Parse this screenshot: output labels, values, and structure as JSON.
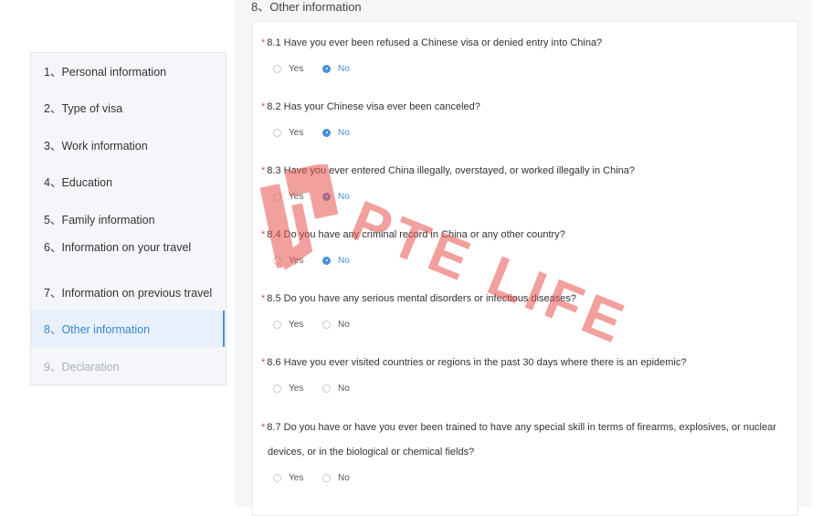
{
  "section": {
    "title": "8、Other information"
  },
  "sidebar": {
    "items": [
      {
        "label": "1、Personal information"
      },
      {
        "label": "2、Type of visa"
      },
      {
        "label": "3、Work information"
      },
      {
        "label": "4、Education"
      },
      {
        "label": "5、Family information"
      },
      {
        "label": "6、Information on your travel"
      },
      {
        "label": "7、Information on previous travel"
      },
      {
        "label": "8、Other information",
        "state": "active"
      },
      {
        "label": "9、Declaration",
        "state": "disabled"
      }
    ]
  },
  "questions": [
    {
      "text": "8.1 Have you ever been refused a Chinese visa or denied entry into China?",
      "selected": "No"
    },
    {
      "text": "8.2 Has your Chinese visa ever been canceled?",
      "selected": "No"
    },
    {
      "text": "8.3 Have you ever entered China illegally, overstayed, or worked illegally in China?",
      "selected": "No"
    },
    {
      "text": "8.4 Do you have any criminal record in China or any other country?",
      "selected": "No"
    },
    {
      "text": "8.5 Do you have any serious mental disorders or infectious diseases?",
      "selected": ""
    },
    {
      "text": "8.6 Have you ever visited countries or regions in the past 30 days where there is an epidemic?",
      "selected": ""
    },
    {
      "text": "8.7 Do you have or have you ever been trained to have any special skill in terms of firearms, explosives, or nuclear",
      "text_line2": "devices, or in the biological or chemical fields?",
      "selected": ""
    }
  ],
  "options": {
    "yes": "Yes",
    "no": "No"
  },
  "required_mark": "*",
  "watermark": {
    "text": "PTE LIFE",
    "color": "#e8544e"
  },
  "colors": {
    "accent": "#4a90d9",
    "required": "#e05050"
  }
}
